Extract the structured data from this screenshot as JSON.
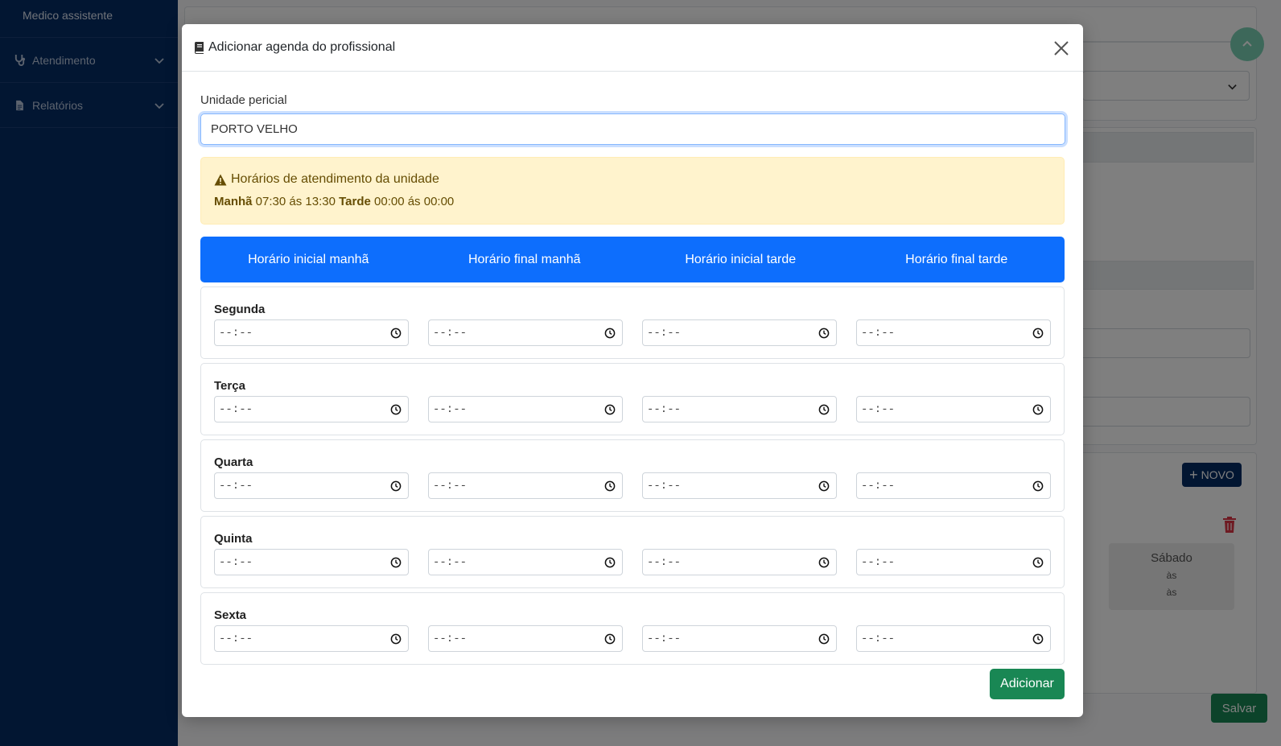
{
  "sidebar": {
    "top_item": "Medico assistente",
    "items": [
      {
        "label": "Atendimento",
        "icon": "stethoscope-icon"
      },
      {
        "label": "Relatórios",
        "icon": "file-icon"
      }
    ]
  },
  "background": {
    "novo_label": "NOVO",
    "sabado": {
      "title": "Sábado",
      "line1": "às",
      "line2": "às"
    },
    "salvar_label": "Salvar"
  },
  "modal": {
    "title": "Adicionar agenda do profissional",
    "unit_label": "Unidade pericial",
    "unit_value": "PORTO VELHO",
    "alert": {
      "title": "Horários de atendimento da unidade",
      "morning_label": "Manhã",
      "morning_value": " 07:30 ás 13:30 ",
      "afternoon_label": "Tarde",
      "afternoon_value": " 00:00 ás 00:00"
    },
    "headers": [
      "Horário inicial manhã",
      "Horário final manhã",
      "Horário inicial tarde",
      "Horário final tarde"
    ],
    "time_placeholder": "--:--",
    "days": [
      "Segunda",
      "Terça",
      "Quarta",
      "Quinta",
      "Sexta"
    ],
    "add_label": "Adicionar"
  },
  "colors": {
    "sidebar_bg": "#052c65",
    "primary": "#0d6efd",
    "success": "#198754",
    "alert_bg": "#fff3cd",
    "alert_text": "#664d03"
  }
}
